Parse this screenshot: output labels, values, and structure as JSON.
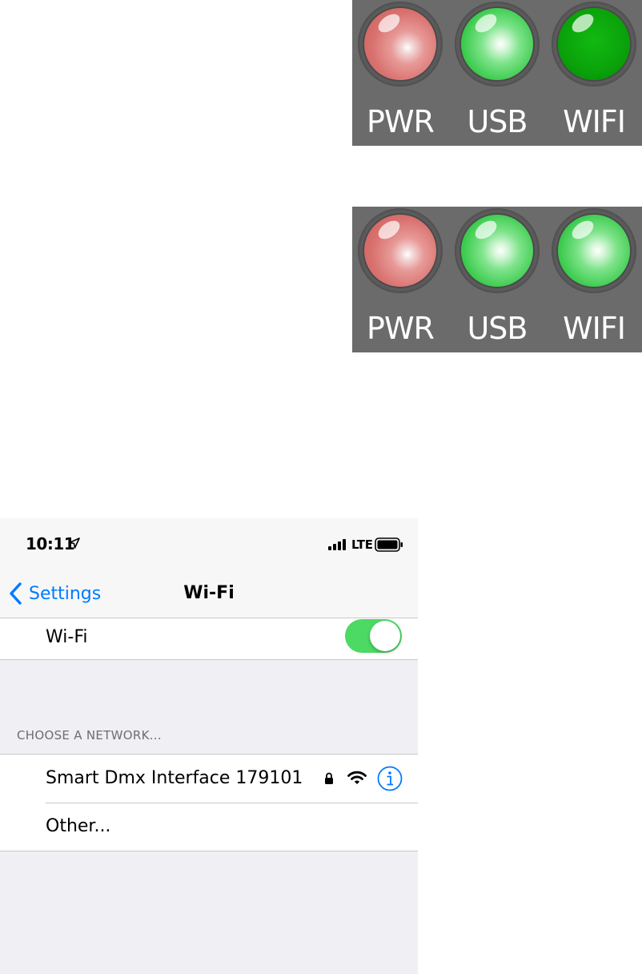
{
  "led_panels": [
    {
      "leds": [
        {
          "label": "PWR",
          "state": "red-lit",
          "color": "#d9716f"
        },
        {
          "label": "USB",
          "state": "green-lit",
          "color": "#3bcb4d"
        },
        {
          "label": "WIFI",
          "state": "green-solid",
          "color": "#0aa20a"
        }
      ]
    },
    {
      "leds": [
        {
          "label": "PWR",
          "state": "red-lit",
          "color": "#d9716f"
        },
        {
          "label": "USB",
          "state": "green-lit",
          "color": "#3bcb4d"
        },
        {
          "label": "WIFI",
          "state": "green-lit",
          "color": "#3bcb4d"
        }
      ]
    }
  ],
  "status_bar": {
    "time": "10:11",
    "location_icon": "location-arrow-icon",
    "signal_icon": "cellular-signal-icon",
    "network_type": "LTE",
    "battery_icon": "battery-icon"
  },
  "nav_bar": {
    "back_label": "Settings",
    "back_icon": "chevron-left-icon",
    "title": "Wi-Fi"
  },
  "wifi_setting": {
    "label": "Wi-Fi",
    "enabled": true
  },
  "networks_section": {
    "header": "CHOOSE A NETWORK...",
    "networks": [
      {
        "name": "Smart Dmx Interface 179101",
        "secured": true,
        "signal_icon": "wifi-icon",
        "info_icon": "info-icon"
      },
      {
        "name": "Other..."
      }
    ]
  },
  "colors": {
    "ios_blue": "#007aff",
    "toggle_on": "#4cd964",
    "panel_grey": "#6b6b6b",
    "grouped_background": "#efeff4"
  }
}
